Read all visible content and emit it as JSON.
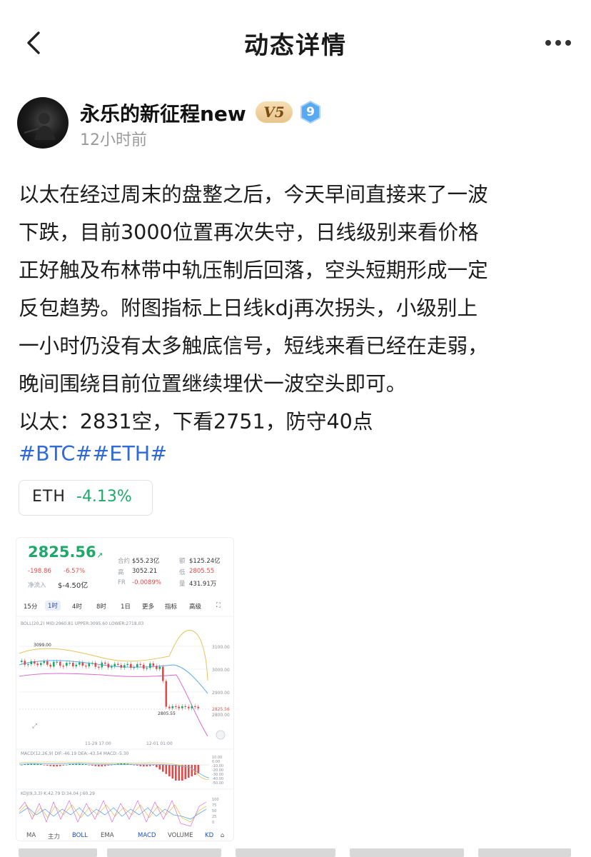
{
  "nav": {
    "title": "动态详情",
    "back_icon": "chevron-left-icon",
    "more_icon": "more-dots-icon"
  },
  "author": {
    "name": "永乐的新征程new",
    "vip_badge": "V5",
    "level": "9",
    "time": "12小时前"
  },
  "post": {
    "lines": [
      "以太在经过周末的盘整之后，今天早间直接来了一波",
      "下跌，目前3000位置再次失守，日线级别来看价格",
      "正好触及布林带中轨压制后回落，空头短期形成一定",
      "反包趋势。附图指标上日线kdj再次拐头，小级别上",
      "一小时仍没有太多触底信号，短线来看已经在走弱，",
      "晚间围绕目前位置继续埋伏一波空头即可。",
      "以太：2831空，下看2751，防守40点"
    ],
    "tags": "#BTC##ETH#"
  },
  "ticker_chip": {
    "symbol": "ETH",
    "change": "-4.13%"
  },
  "screenshot": {
    "price": "2825.56",
    "change_abs": "-198.86",
    "change_pct": "-6.57%",
    "netflow_label": "净流入",
    "netflow_value": "$-4.50亿",
    "stats": [
      {
        "label": "合约",
        "value": "$55.23亿"
      },
      {
        "label": "额",
        "value": "$125.24亿"
      },
      {
        "label": "高",
        "value": "3052.21"
      },
      {
        "label": "低",
        "value": "2805.55"
      },
      {
        "label": "FR",
        "value": "-0.0089%"
      },
      {
        "label": "量",
        "value": "431.91万"
      }
    ],
    "timeframes": [
      "15分",
      "1时",
      "4时",
      "8时",
      "1日",
      "更多",
      "指标",
      "高级"
    ],
    "boll_label": "BOLL(20,2) MID:2960.81 UPPER:3095.60 LOWER:2718.03",
    "price_axis": [
      "3100.00",
      "3000.00",
      "2900.00",
      "2825.56",
      "2800.00"
    ],
    "high_marker": "3099.00",
    "low_marker": "2805.55",
    "time_labels": [
      "11-29 17:00",
      "12-01 01:00"
    ],
    "macd_label": "MACD(12,26,9) DIF:-46.19 DEA:-43.54 MACD:-5.30",
    "macd_axis": [
      "10.00",
      "0.00",
      "-10.00",
      "-20.00",
      "-30.00",
      "-40.00",
      "-50.00"
    ],
    "kdj_label": "KDJ(9,3,3) K:42.79 D:34.04 J:60.29",
    "kdj_axis": [
      "100",
      "75",
      "50",
      "25",
      "0"
    ],
    "bottom_tabs": [
      "MA",
      "主力",
      "BOLL",
      "EMA",
      "MACD",
      "VOLUME",
      "KD"
    ],
    "colors": {
      "up": "#1ea86a",
      "down": "#e24a4a",
      "boll_upper": "#e8c35a",
      "boll_mid": "#5aa8e8",
      "boll_lower": "#d86bd0"
    }
  }
}
